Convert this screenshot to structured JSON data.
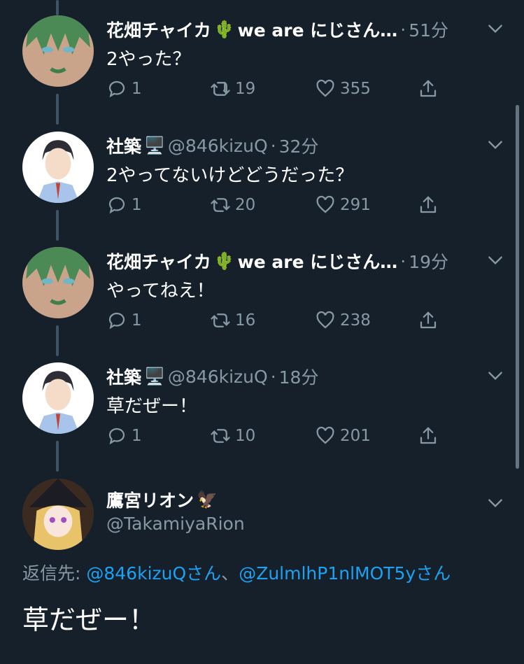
{
  "tweets": [
    {
      "name": "花畑チャイカ",
      "name_suffix": "we are にじさん…",
      "name_emoji": "🌵",
      "handle": "",
      "dot": "·",
      "time": "51分",
      "text": "2やった？",
      "replies": "1",
      "retweets": "19",
      "likes": "355"
    },
    {
      "name": "社築",
      "name_suffix": "",
      "name_emoji": "🖥️",
      "handle": "@846kizuQ",
      "dot": "·",
      "time": "32分",
      "text": "2やってないけどどうだった？",
      "replies": "1",
      "retweets": "20",
      "likes": "291"
    },
    {
      "name": "花畑チャイカ",
      "name_suffix": "we are にじさん…",
      "name_emoji": "🌵",
      "handle": "",
      "dot": "·",
      "time": "19分",
      "text": "やってねえ！",
      "replies": "1",
      "retweets": "16",
      "likes": "238"
    },
    {
      "name": "社築",
      "name_suffix": "",
      "name_emoji": "🖥️",
      "handle": "@846kizuQ",
      "dot": "·",
      "time": "18分",
      "text": "草だぜー！",
      "replies": "1",
      "retweets": "10",
      "likes": "201"
    }
  ],
  "main": {
    "name": "鷹宮リオン",
    "name_emoji": "🦅",
    "handle": "@TakamiyaRion",
    "reply_prefix": "返信先: ",
    "reply_user1": "@846kizuQさん",
    "reply_sep": "、",
    "reply_user2": "@ZulmlhP1nlMOT5yさん",
    "text": "草だぜー！"
  },
  "colors": {
    "background": "#15202b",
    "secondary_text": "#8899a6",
    "link": "#1da1f2",
    "thread_line": "#3d5466"
  },
  "icons": [
    "reply-icon",
    "retweet-icon",
    "like-icon",
    "share-icon",
    "chevron-down-icon"
  ]
}
